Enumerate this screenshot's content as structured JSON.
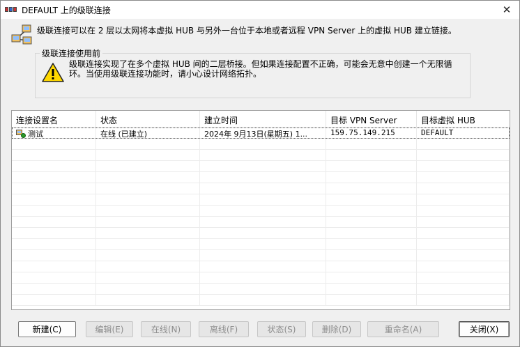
{
  "window": {
    "title": "DEFAULT 上的级联连接",
    "close_glyph": "✕"
  },
  "intro": {
    "text": "级联连接可以在 2 层以太网将本虚拟 HUB 与另外一台位于本地或者远程 VPN Server 上的虚拟 HUB 建立链接。"
  },
  "notice": {
    "legend": "级联连接使用前",
    "icon": "warning-icon",
    "text": "级联连接实现了在多个虚拟 HUB 间的二层桥接。但如果连接配置不正确，可能会无意中创建一个无限循环。当使用级联连接功能时，请小心设计网络拓扑。"
  },
  "table": {
    "columns": [
      "连接设置名",
      "状态",
      "建立时间",
      "目标 VPN Server",
      "目标虚拟 HUB"
    ],
    "rows": [
      {
        "name": "测试",
        "status": "在线 (已建立)",
        "established": "2024年 9月13日(星期五) 1...",
        "server": "159.75.149.215",
        "hub": "DEFAULT"
      }
    ]
  },
  "buttons": {
    "new": "新建(C)",
    "edit": "编辑(E)",
    "online": "在线(N)",
    "offline": "离线(F)",
    "status": "状态(S)",
    "delete": "删除(D)",
    "rename": "重命名(A)",
    "close": "关闭(X)"
  },
  "colors": {
    "warning_yellow": "#ffd800",
    "selection_outline": "#555555"
  }
}
